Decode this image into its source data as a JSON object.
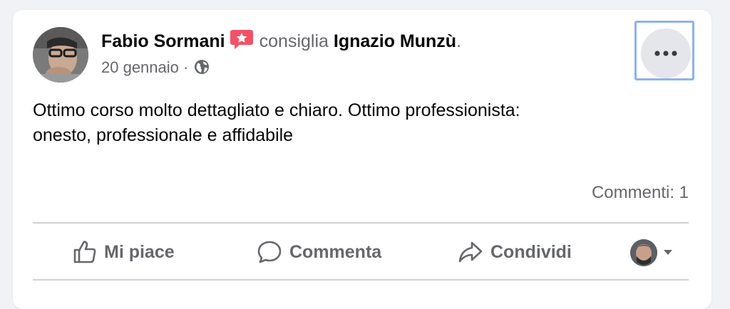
{
  "post": {
    "author": "Fabio Sormani",
    "action_text": "consiglia",
    "recommended_page": "Ignazio Munzù",
    "trailing_period": ".",
    "date": "20 gennaio",
    "separator": "·",
    "text_line1": "Ottimo corso molto dettagliato e chiaro. Ottimo professionista:",
    "text_line2": "onesto, professionale e affidabile",
    "comments_count": "Commenti: 1"
  },
  "actions": {
    "like": "Mi piace",
    "comment": "Commenta",
    "share": "Condividi"
  },
  "icons": {
    "recommend_badge": "recommend-badge-icon",
    "privacy": "globe-icon",
    "more": "more-options-icon",
    "like": "thumbs-up-icon",
    "comment": "comment-bubble-icon",
    "share": "share-arrow-icon",
    "viewer_menu": "caret-down-icon"
  },
  "colors": {
    "badge": "#f25268",
    "focus_ring": "#8fb0ee",
    "secondary_text": "#65676b"
  }
}
